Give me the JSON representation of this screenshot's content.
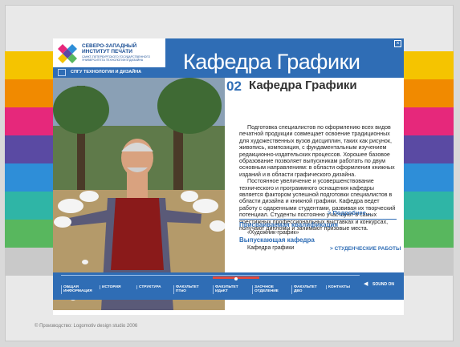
{
  "colors": {
    "accent": "#2f6db5",
    "stripes": [
      "#f5c400",
      "#f18a00",
      "#e6287b",
      "#5a4aa3",
      "#2e8ed8",
      "#2fb5a6",
      "#58b75e",
      "#c9c9c9"
    ]
  },
  "logo": {
    "title": "СЕВЕРО-ЗАПАДНЫЙ ИНСТИТУТ ПЕЧАТИ",
    "subtitle": "САНКТ-ПЕТЕРБУРГСКОГО ГОСУДАРСТВЕННОГО УНИВЕРСИТЕТА ТЕХНОЛОГИИ И ДИЗАЙНА",
    "strip": "СПГУ ТЕХНОЛОГИИ И ДИЗАЙНА"
  },
  "header": {
    "title": "Кафедра Графики",
    "close_icon": "close-icon",
    "close_glyph": "×"
  },
  "section": {
    "number": "02",
    "title": "Кафедра Графики"
  },
  "content": {
    "paragraphs": [
      "Подготовка специалистов по оформлению всех видов печатной продукции совмещает освоение традиционных для художественных вузов дисциплин, таких как рисунок, живопись, композиция, с фундаментальным изучением редакционно-издательских процессов. Хорошее базовое образование позволяет выпускникам работать по двум основным направлениям: в области оформления книжных изданий и в области графического дизайна.",
      "Постоянное увеличение и усовершенствование технического и программного оснащения кафедры является фактором успешной подготовки специалистов в области дизайна и книжной графики. Кафедра ведет работу с одаренными студентами, развивая их творческий потенциал. Студенты постоянно участвуют в самых престижных профессиональных выставках и конкурсах, получают дипломы и занимают призовые места."
    ],
    "more_link": "> Подробнее...",
    "qualification_heading": "Присваиваемая квалификация",
    "qualification_value": "«Художник-график»",
    "department_heading": "Выпускающая кафедра",
    "department_value": "Кафедра графики",
    "students_link": "> СТУДЕНЧЕСКИЕ РАБОТЫ"
  },
  "nav": {
    "items": [
      "ОБЩАЯ ИНФОРМАЦИЯ",
      "ИСТОРИЯ",
      "СТРУКТУРА",
      "ФАКУЛЬТЕТ ПТиО",
      "ФАКУЛЬТЕТ ИДиКТ",
      "ЗАОЧНОЕ ОТДЕЛЕНИЕ",
      "ФАКУЛЬТЕТ ДВО",
      "КОНТАКТЫ"
    ],
    "sound_label": "SOUND ON",
    "sound_icon": "speaker-icon",
    "sound_glyph": "◀"
  },
  "footer": {
    "text": "© Производство: Logomotiv design studio 2006"
  }
}
